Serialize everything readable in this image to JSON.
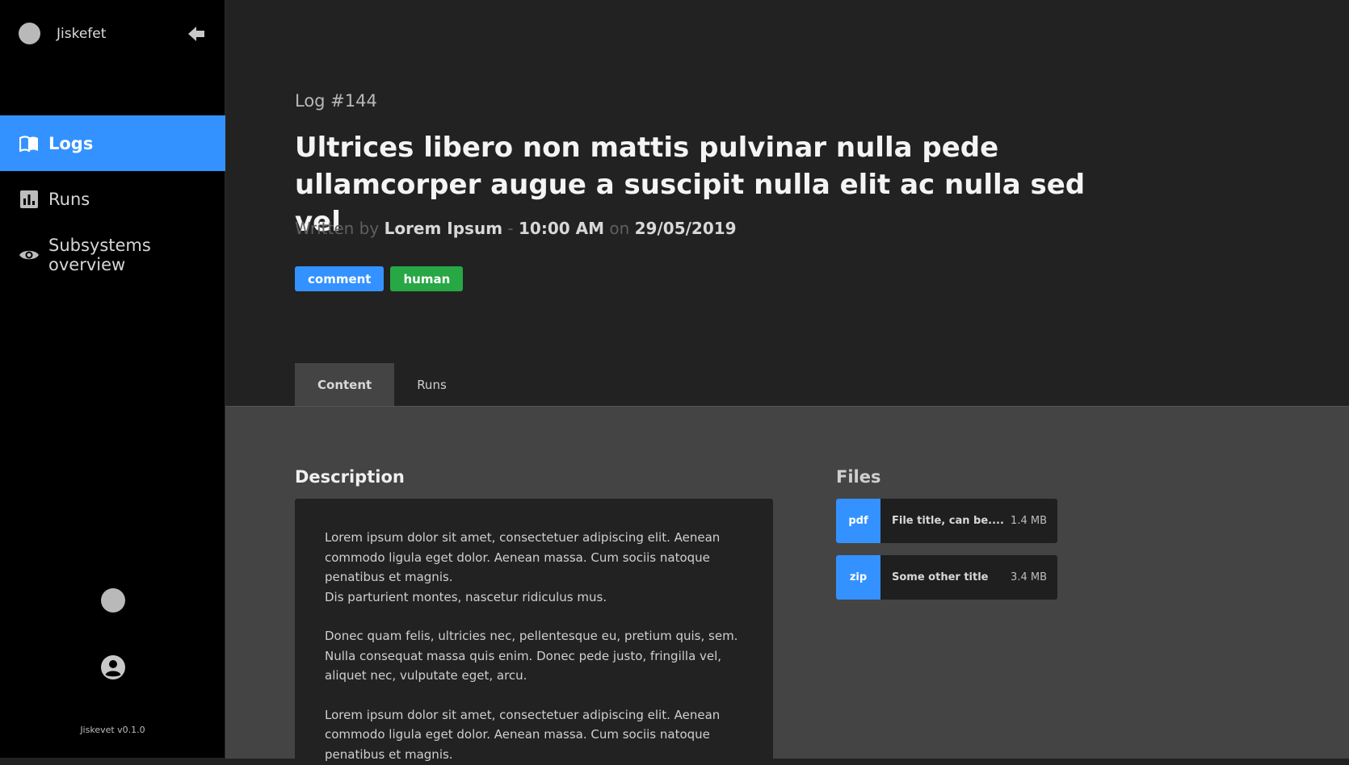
{
  "sidebar": {
    "brand": "Jiskefet",
    "items": [
      {
        "label": "Logs",
        "icon": "book-icon",
        "active": true
      },
      {
        "label": "Runs",
        "icon": "bar-chart-icon",
        "active": false
      },
      {
        "label": "Subsystems overview",
        "icon": "eye-icon",
        "active": false
      }
    ],
    "version": "Jiskevet v0.1.0"
  },
  "log": {
    "id_label": "Log #144",
    "title": "Ultrices libero non mattis pulvinar nulla pede ullamcorper augue a suscipit nulla elit ac nulla sed vel",
    "written_by_prefix": "Written by",
    "author": "Lorem Ipsum",
    "separator": "-",
    "time": "10:00 AM",
    "on_word": "on",
    "date": "29/05/2019",
    "tags": [
      {
        "label": "comment",
        "color": "#3392ff"
      },
      {
        "label": "human",
        "color": "#28a745"
      }
    ]
  },
  "tabs": [
    {
      "label": "Content",
      "active": true
    },
    {
      "label": "Runs",
      "active": false
    }
  ],
  "description": {
    "heading": "Description",
    "paragraphs": [
      "Lorem ipsum dolor sit amet, consectetuer adipiscing elit. Aenean commodo ligula eget dolor. Aenean massa. Cum sociis natoque penatibus et magnis.\nDis parturient montes, nascetur ridiculus mus.",
      "Donec quam felis, ultricies nec, pellentesque eu, pretium quis, sem. Nulla consequat massa quis enim. Donec pede justo, fringilla vel, aliquet nec, vulputate eget, arcu.",
      "Lorem ipsum dolor sit amet, consectetuer adipiscing elit. Aenean commodo ligula eget dolor. Aenean massa. Cum sociis natoque penatibus et magnis."
    ]
  },
  "files": {
    "heading": "Files",
    "items": [
      {
        "ext": "pdf",
        "name": "File title, can be....",
        "size": "1.4 MB"
      },
      {
        "ext": "zip",
        "name": "Some other title",
        "size": "3.4 MB"
      }
    ]
  },
  "colors": {
    "accent": "#3392ff",
    "success": "#28a745"
  }
}
